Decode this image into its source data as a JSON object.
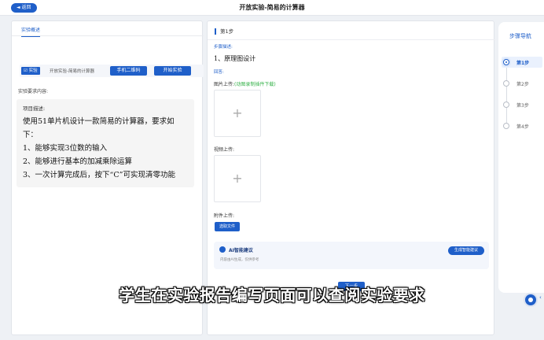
{
  "header": {
    "back_label": "◄ 返回",
    "title": "开放实验-简易的计算器"
  },
  "left": {
    "tab_label": "实验概述",
    "experiment": {
      "tag": "☑ 实验",
      "name": "开放实验-简易的计算器"
    },
    "qr_button": "手机二维码",
    "start_button": "开始实验",
    "requirements_label": "实验要求内容:",
    "requirements": {
      "title": "项目描述:",
      "lines": [
        "使用51单片机设计一款简易的计算器，要求如",
        "下：",
        "1、能够实现3位数的输入",
        "2、能够进行基本的加减乘除运算",
        "3、一次计算完成后，按下“C”可实现清零功能"
      ]
    }
  },
  "main": {
    "step_title": "第1步",
    "step_desc_label": "步骤描述:",
    "step_desc": "1、原理图设计",
    "answer_label": "回答:",
    "image_upload_label": "图片上传:",
    "image_upload_hint": "(动图录制插件下载)",
    "video_upload_label": "视频上传:",
    "attachment_label": "附件上传:",
    "choose_file": "选取文件",
    "plus_glyph": "+",
    "ai": {
      "title": "AI智能建议",
      "subtitle": "内容由AI生成，仅供参考",
      "button": "生成智能建议"
    },
    "submit": "下一步"
  },
  "nav": {
    "title": "步骤导航",
    "steps": [
      "第1步",
      "第2步",
      "第3步",
      "第4步"
    ],
    "active_index": 0
  },
  "subtitle": "学生在实验报告编写页面可以查阅实验要求",
  "colors": {
    "primary": "#1f5fc9",
    "hint_green": "#36b24a"
  }
}
